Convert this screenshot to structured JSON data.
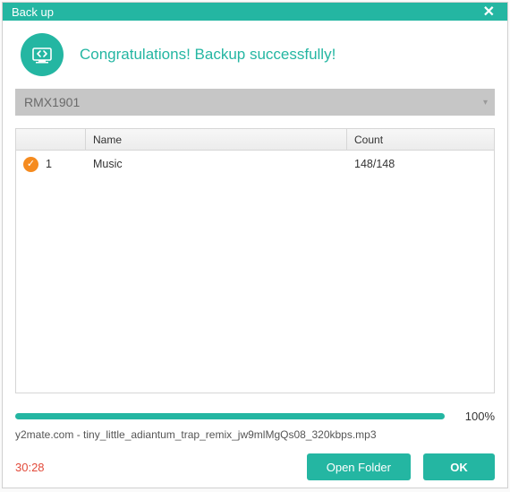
{
  "window": {
    "title": "Back up"
  },
  "header": {
    "message": "Congratulations! Backup successfully!"
  },
  "device": {
    "name": "RMX1901"
  },
  "table": {
    "columns": {
      "name": "Name",
      "count": "Count"
    },
    "rows": [
      {
        "index": "1",
        "name": "Music",
        "count": "148/148"
      }
    ]
  },
  "progress": {
    "percent_text": "100%",
    "percent_value": 100,
    "filename": "y2mate.com - tiny_little_adiantum_trap_remix_jw9mlMgQs08_320kbps.mp3"
  },
  "timer": "30:28",
  "buttons": {
    "open_folder": "Open Folder",
    "ok": "OK"
  }
}
